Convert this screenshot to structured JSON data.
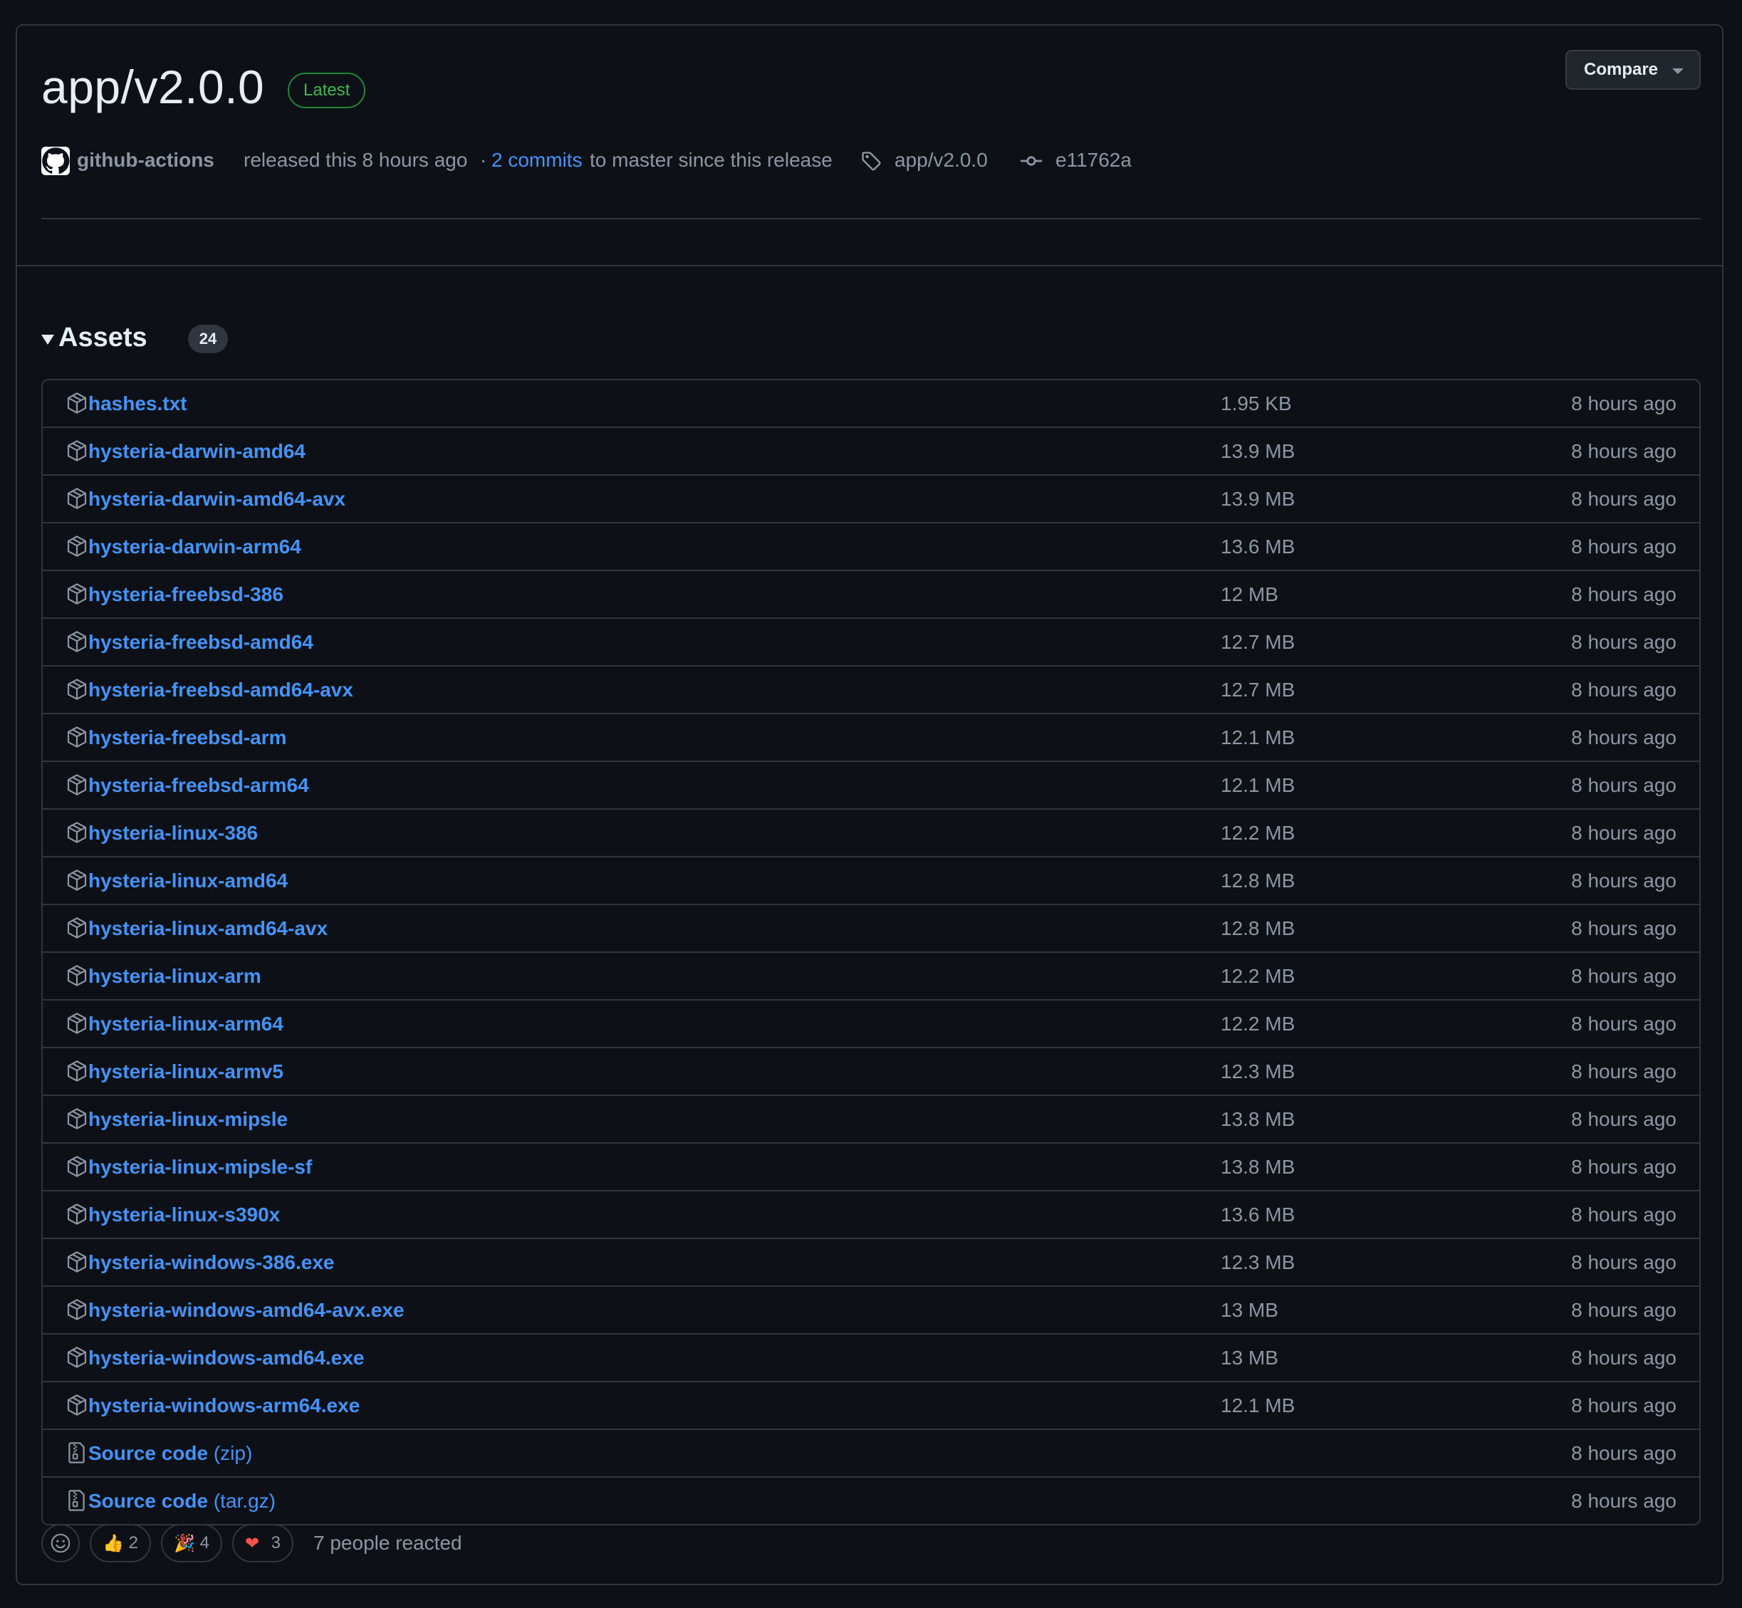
{
  "release": {
    "title": "app/v2.0.0",
    "badge": "Latest",
    "compare_label": "Compare",
    "actor": "github-actions",
    "released_text": "released this 8 hours ago",
    "separator": "·",
    "commits_link": "2 commits",
    "commits_suffix": "to master since this release",
    "tag": "app/v2.0.0",
    "commit_sha": "e11762a"
  },
  "assets": {
    "title": "Assets",
    "count": "24",
    "items": [
      {
        "name": "hashes.txt",
        "size": "1.95 KB",
        "date": "8 hours ago"
      },
      {
        "name": "hysteria-darwin-amd64",
        "size": "13.9 MB",
        "date": "8 hours ago"
      },
      {
        "name": "hysteria-darwin-amd64-avx",
        "size": "13.9 MB",
        "date": "8 hours ago"
      },
      {
        "name": "hysteria-darwin-arm64",
        "size": "13.6 MB",
        "date": "8 hours ago"
      },
      {
        "name": "hysteria-freebsd-386",
        "size": "12 MB",
        "date": "8 hours ago"
      },
      {
        "name": "hysteria-freebsd-amd64",
        "size": "12.7 MB",
        "date": "8 hours ago"
      },
      {
        "name": "hysteria-freebsd-amd64-avx",
        "size": "12.7 MB",
        "date": "8 hours ago"
      },
      {
        "name": "hysteria-freebsd-arm",
        "size": "12.1 MB",
        "date": "8 hours ago"
      },
      {
        "name": "hysteria-freebsd-arm64",
        "size": "12.1 MB",
        "date": "8 hours ago"
      },
      {
        "name": "hysteria-linux-386",
        "size": "12.2 MB",
        "date": "8 hours ago"
      },
      {
        "name": "hysteria-linux-amd64",
        "size": "12.8 MB",
        "date": "8 hours ago"
      },
      {
        "name": "hysteria-linux-amd64-avx",
        "size": "12.8 MB",
        "date": "8 hours ago"
      },
      {
        "name": "hysteria-linux-arm",
        "size": "12.2 MB",
        "date": "8 hours ago"
      },
      {
        "name": "hysteria-linux-arm64",
        "size": "12.2 MB",
        "date": "8 hours ago"
      },
      {
        "name": "hysteria-linux-armv5",
        "size": "12.3 MB",
        "date": "8 hours ago"
      },
      {
        "name": "hysteria-linux-mipsle",
        "size": "13.8 MB",
        "date": "8 hours ago"
      },
      {
        "name": "hysteria-linux-mipsle-sf",
        "size": "13.8 MB",
        "date": "8 hours ago"
      },
      {
        "name": "hysteria-linux-s390x",
        "size": "13.6 MB",
        "date": "8 hours ago"
      },
      {
        "name": "hysteria-windows-386.exe",
        "size": "12.3 MB",
        "date": "8 hours ago"
      },
      {
        "name": "hysteria-windows-amd64-avx.exe",
        "size": "13 MB",
        "date": "8 hours ago"
      },
      {
        "name": "hysteria-windows-amd64.exe",
        "size": "13 MB",
        "date": "8 hours ago"
      },
      {
        "name": "hysteria-windows-arm64.exe",
        "size": "12.1 MB",
        "date": "8 hours ago"
      }
    ],
    "source": [
      {
        "name": "Source code",
        "format": "(zip)",
        "date": "8 hours ago"
      },
      {
        "name": "Source code",
        "format": "(tar.gz)",
        "date": "8 hours ago"
      }
    ]
  },
  "reactions": {
    "items": [
      {
        "emoji": "👍",
        "icon": "thumbs-up-icon",
        "count": "2"
      },
      {
        "emoji": "🎉",
        "icon": "party-popper-icon",
        "count": "4"
      },
      {
        "emoji": "❤",
        "icon": "heart-icon",
        "count": "3"
      }
    ],
    "summary": "7 people reacted"
  },
  "colors": {
    "background": "#0d1117",
    "border": "#30363d",
    "link": "#4493f8",
    "muted": "#8d96a0",
    "latest_green": "#3fb950"
  }
}
